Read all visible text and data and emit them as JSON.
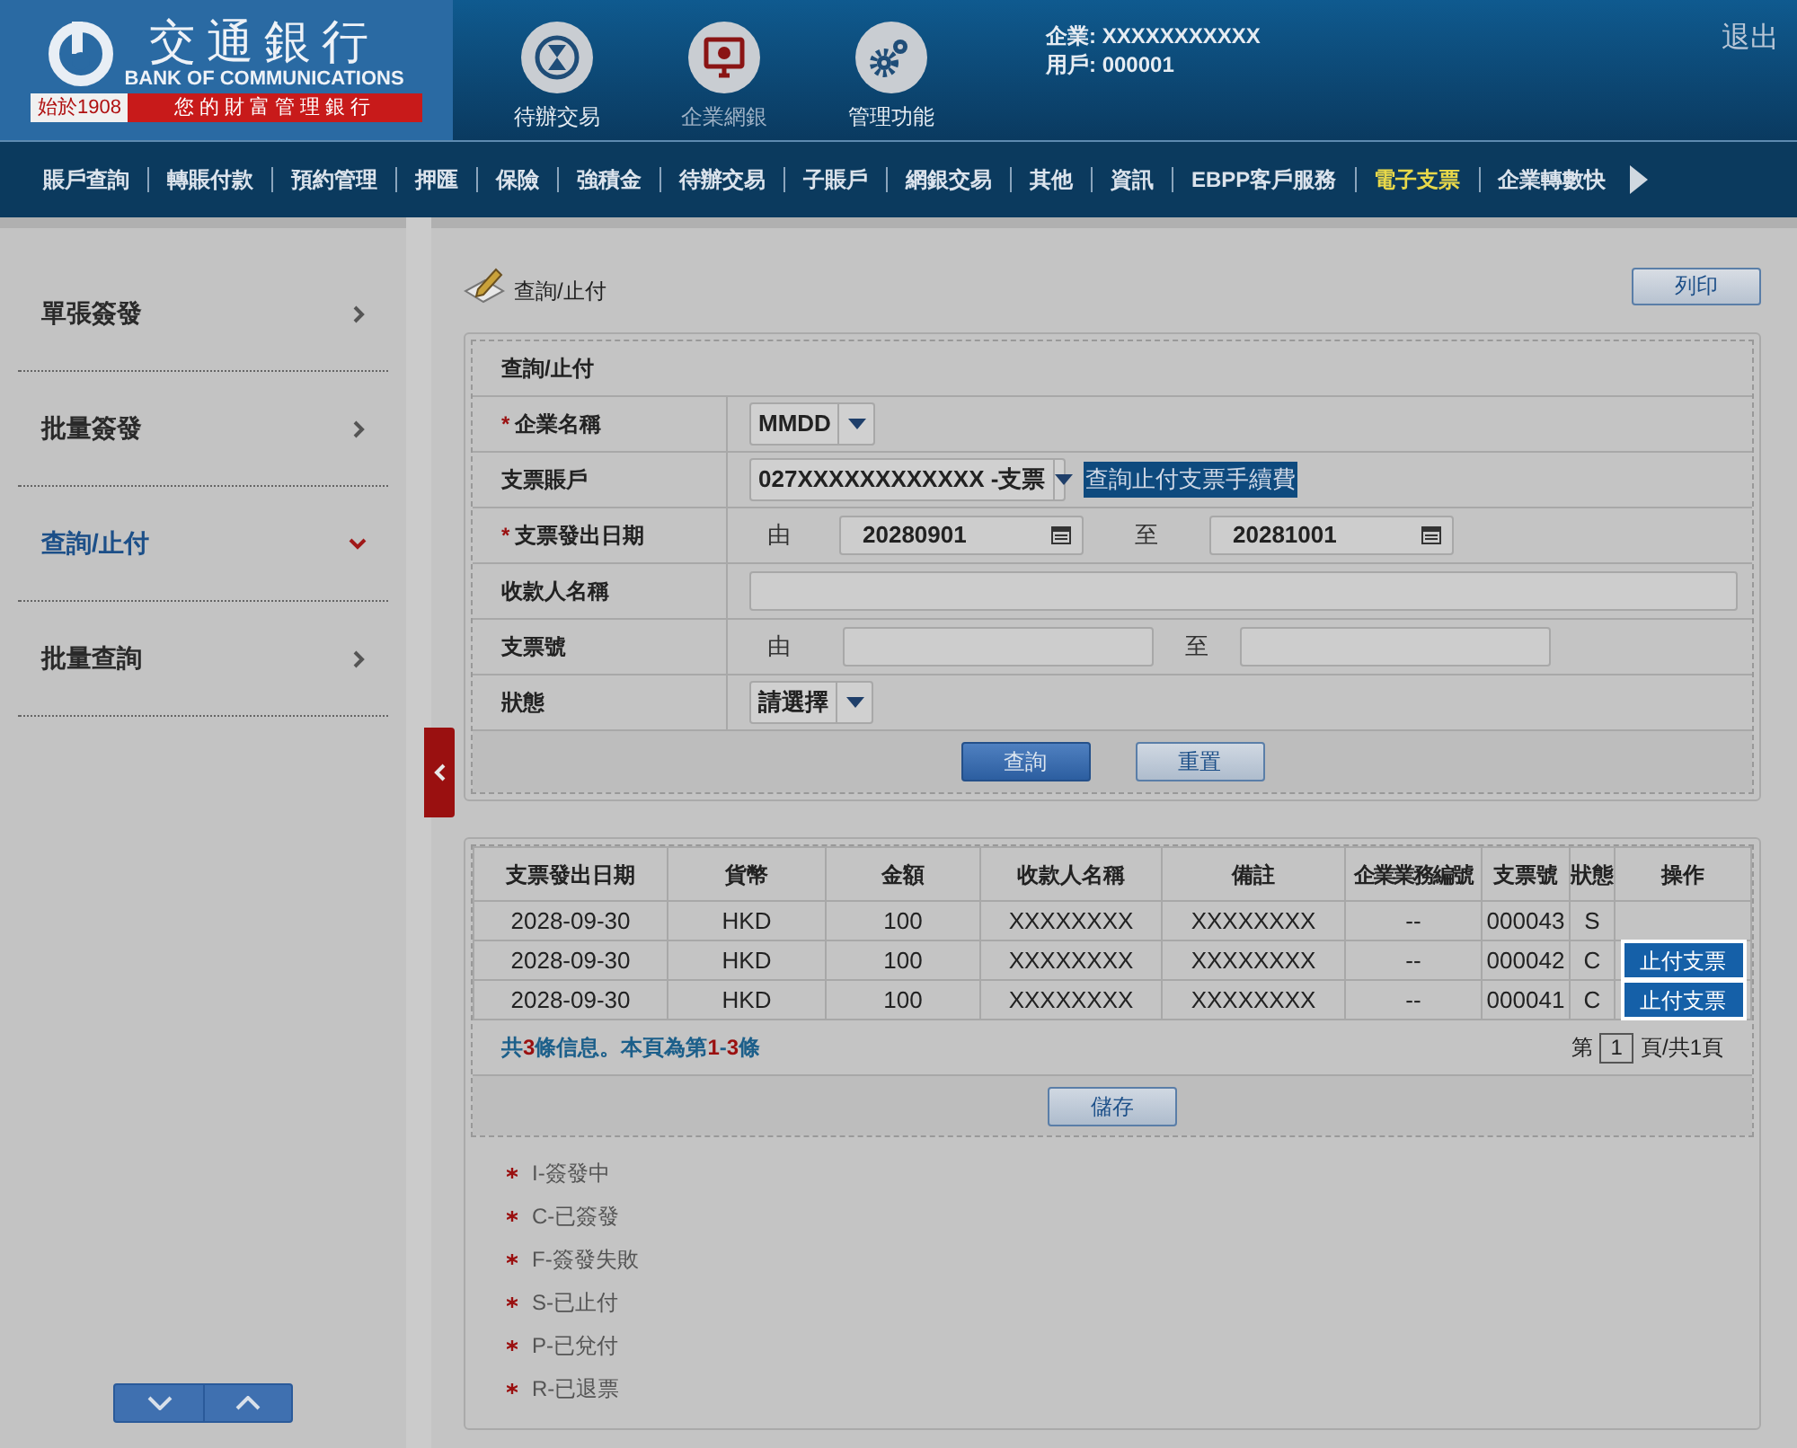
{
  "logo": {
    "name": "交通銀行",
    "english": "BANK OF COMMUNICATIONS",
    "since": "始於1908",
    "slogan": "您的財富管理銀行"
  },
  "top_menu": [
    {
      "label": "待辦交易",
      "kind": "hourglass",
      "selected": false
    },
    {
      "label": "企業網銀",
      "kind": "monitor",
      "selected": true
    },
    {
      "label": "管理功能",
      "kind": "gears",
      "selected": false
    }
  ],
  "user": {
    "company": "企業: XXXXXXXXXXX",
    "user": "用戶: 000001"
  },
  "logout": "退出",
  "nav": [
    {
      "label": "賬戶查詢",
      "selected": false
    },
    {
      "label": "轉賬付款",
      "selected": false
    },
    {
      "label": "預約管理",
      "selected": false
    },
    {
      "label": "押匯",
      "selected": false
    },
    {
      "label": "保險",
      "selected": false
    },
    {
      "label": "強積金",
      "selected": false
    },
    {
      "label": "待辦交易",
      "selected": false
    },
    {
      "label": "子賬戶",
      "selected": false
    },
    {
      "label": "網銀交易",
      "selected": false
    },
    {
      "label": "其他",
      "selected": false
    },
    {
      "label": "資訊",
      "selected": false
    },
    {
      "label": "EBPP客戶服務",
      "selected": false
    },
    {
      "label": "電子支票",
      "selected": true
    },
    {
      "label": "企業轉數快",
      "selected": false
    }
  ],
  "sidebar": {
    "items": [
      {
        "label": "單張簽發",
        "expanded": false
      },
      {
        "label": "批量簽發",
        "expanded": false
      },
      {
        "label": "查詢/止付",
        "expanded": true
      },
      {
        "label": "批量查詢",
        "expanded": false
      }
    ]
  },
  "page": {
    "title": "查詢/止付",
    "print_button": "列印"
  },
  "form": {
    "title": "查詢/止付",
    "rows": [
      {
        "marker": "*",
        "label": "企業名稱",
        "kind": "select",
        "value": "MMDD"
      },
      {
        "label": "支票賬戶",
        "kind": "select_link",
        "value": "027XXXXXXXXXXXX -支票",
        "link": "查詢止付支票手續費"
      },
      {
        "marker": "*",
        "label": "支票發出日期",
        "kind": "date_range",
        "from_label": "由",
        "from": "20280901",
        "to_label": "至",
        "to": "20281001"
      },
      {
        "label": "收款人名稱",
        "kind": "text"
      },
      {
        "label": "支票號",
        "kind": "range",
        "from_label": "由",
        "to_label": "至"
      },
      {
        "label": "狀態",
        "kind": "select",
        "value": "請選擇"
      }
    ],
    "buttons": [
      {
        "label": "查詢",
        "primary": true
      },
      {
        "label": "重置",
        "primary": false
      }
    ]
  },
  "results": {
    "columns": [
      "支票發出日期",
      "貨幣",
      "金額",
      "收款人名稱",
      "備註",
      "企業業務編號",
      "支票號",
      "狀態",
      "操作"
    ],
    "rows": [
      {
        "cells": [
          "2028-09-30",
          "HKD",
          "100",
          "XXXXXXXX",
          "XXXXXXXX",
          "--",
          "000043",
          "S"
        ]
      },
      {
        "cells": [
          "2028-09-30",
          "HKD",
          "100",
          "XXXXXXXX",
          "XXXXXXXX",
          "--",
          "000042",
          "C"
        ],
        "action": "止付支票"
      },
      {
        "cells": [
          "2028-09-30",
          "HKD",
          "100",
          "XXXXXXXX",
          "XXXXXXXX",
          "--",
          "000041",
          "C"
        ],
        "action": "止付支票"
      }
    ],
    "summary": [
      {
        "text": "共",
        "highlight": false
      },
      {
        "text": "3",
        "highlight": true
      },
      {
        "text": "條信息。本頁為第",
        "highlight": false
      },
      {
        "text": "1",
        "highlight": true
      },
      {
        "text": "-",
        "highlight": false
      },
      {
        "text": "3",
        "highlight": true
      },
      {
        "text": "條",
        "highlight": false
      }
    ],
    "pager": {
      "before": "第",
      "page": "1",
      "after": "頁/共1頁"
    },
    "save_button": "儲存"
  },
  "legend": [
    "I-簽發中",
    "C-已簽發",
    "F-簽發失敗",
    "S-已止付",
    "P-已兌付",
    "R-已退票"
  ]
}
